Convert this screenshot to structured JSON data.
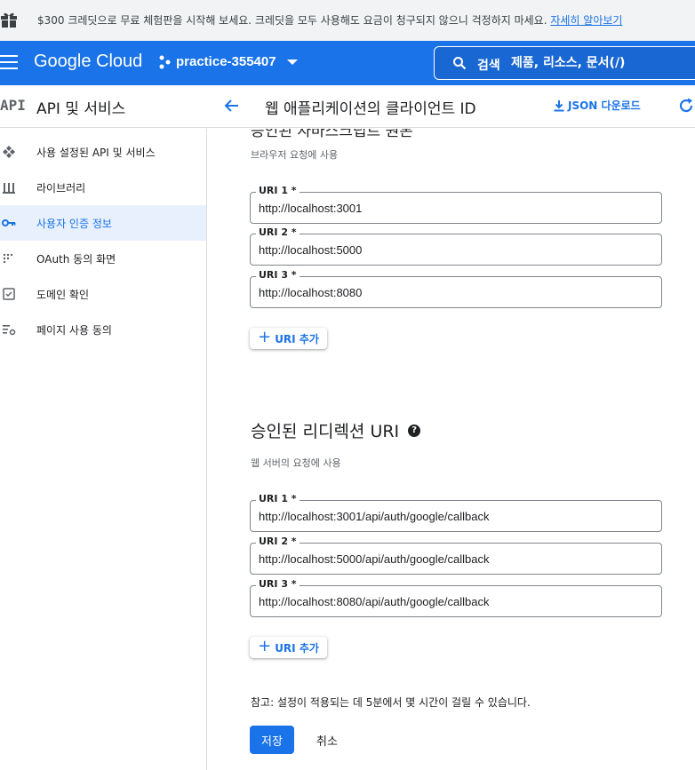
{
  "banner": {
    "text": "$300 크레딧으로 무료 체험판을 시작해 보세요. 크레딧을 모두 사용해도 요금이 청구되지 않으니 걱정하지 마세요. ",
    "link": "자세히 알아보기"
  },
  "appbar": {
    "logo": "Google Cloud",
    "project": "practice-355407",
    "search_label": "검색",
    "search_placeholder": "제품, 리소스, 문서(/)"
  },
  "subheader": {
    "api_logo": "API",
    "section_title": "API 및 서비스",
    "page_title": "웹 애플리케이션의 클라이언트 ID",
    "json_download": "JSON 다운로드"
  },
  "sidebar": {
    "items": [
      {
        "label": "사용 설정된 API 및 서비스",
        "icon": "api-services-icon"
      },
      {
        "label": "라이브러리",
        "icon": "library-icon"
      },
      {
        "label": "사용자 인증 정보",
        "icon": "key-icon",
        "active": true
      },
      {
        "label": "OAuth 동의 화면",
        "icon": "consent-icon"
      },
      {
        "label": "도메인 확인",
        "icon": "checkbox-icon"
      },
      {
        "label": "페이지 사용 동의",
        "icon": "settings-list-icon"
      }
    ]
  },
  "main": {
    "origins_heading_cut": "승인된 자바스크립트 원본",
    "origins_desc": "브라우저 요청에 사용",
    "origins": [
      {
        "label": "URI 1 *",
        "value": "http://localhost:3001"
      },
      {
        "label": "URI 2 *",
        "value": "http://localhost:5000"
      },
      {
        "label": "URI 3 *",
        "value": "http://localhost:8080"
      }
    ],
    "add_uri": "URI 추가",
    "redirect_heading": "승인된 리디렉션 URI",
    "redirect_desc": "웹 서버의 요청에 사용",
    "redirects": [
      {
        "label": "URI 1 *",
        "value": "http://localhost:3001/api/auth/google/callback"
      },
      {
        "label": "URI 2 *",
        "value": "http://localhost:5000/api/auth/google/callback"
      },
      {
        "label": "URI 3 *",
        "value": "http://localhost:8080/api/auth/google/callback"
      }
    ],
    "note": "참고: 설정이 적용되는 데 5분에서 몇 시간이 걸릴 수 있습니다.",
    "save": "저장",
    "cancel": "취소"
  },
  "colors": {
    "primary": "#1a73e8",
    "active_bg": "#e8f0fe",
    "banner_bg": "#f1f3f4"
  }
}
